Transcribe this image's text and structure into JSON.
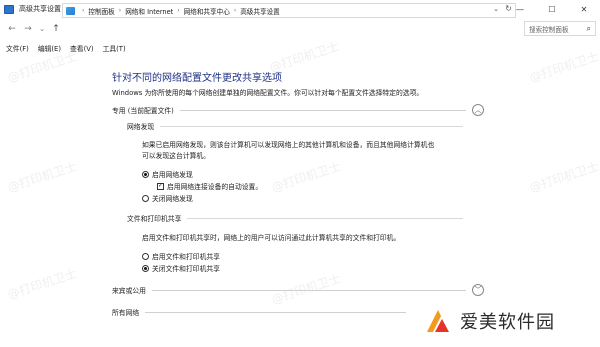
{
  "window": {
    "title": "高级共享设置",
    "controls": {
      "minimize": "—",
      "maximize": "☐",
      "close": "✕"
    }
  },
  "nav": {
    "back": "←",
    "forward": "→",
    "recent": "⌄",
    "up": "↑",
    "breadcrumb": [
      "控制面板",
      "网络和 Internet",
      "网络和共享中心",
      "高级共享设置"
    ],
    "search_placeholder": "搜索控制面板",
    "search_icon": "search-icon"
  },
  "menu": [
    "文件(F)",
    "编辑(E)",
    "查看(V)",
    "工具(T)"
  ],
  "main": {
    "heading": "针对不同的网络配置文件更改共享选项",
    "subtitle": "Windows 为你所使用的每个网络创建单独的网络配置文件。你可以针对每个配置文件选择特定的选项。",
    "private_section": {
      "label": "专用 (当前配置文件)",
      "expanded": true,
      "network_discovery": {
        "label": "网络发现",
        "description_line1": "如果已启用网络发现，则该台计算机可以发现网络上的其他计算机和设备，而且其他网络计算机也",
        "description_line2": "可以发现这台计算机。",
        "on_label": "启用网络发现",
        "on_selected": true,
        "auto_setup_label": "启用网络连接设备的自动设置。",
        "auto_setup_checked": true,
        "off_label": "关闭网络发现",
        "off_selected": false
      },
      "file_printer_sharing": {
        "label": "文件和打印机共享",
        "description": "启用文件和打印机共享时，网络上的用户可以访问通过此计算机共享的文件和打印机。",
        "on_label": "启用文件和打印机共享",
        "on_selected": false,
        "off_label": "关闭文件和打印机共享",
        "off_selected": true
      }
    },
    "guest_section": {
      "label": "来宾或公用",
      "expanded": false
    },
    "all_networks_section": {
      "label": "所有网络",
      "expanded": false
    }
  },
  "watermark": "@打印机卫士",
  "logo": {
    "text": "爱美软件园",
    "colors": {
      "orange": "#f39a1d",
      "red": "#e5332a"
    }
  }
}
